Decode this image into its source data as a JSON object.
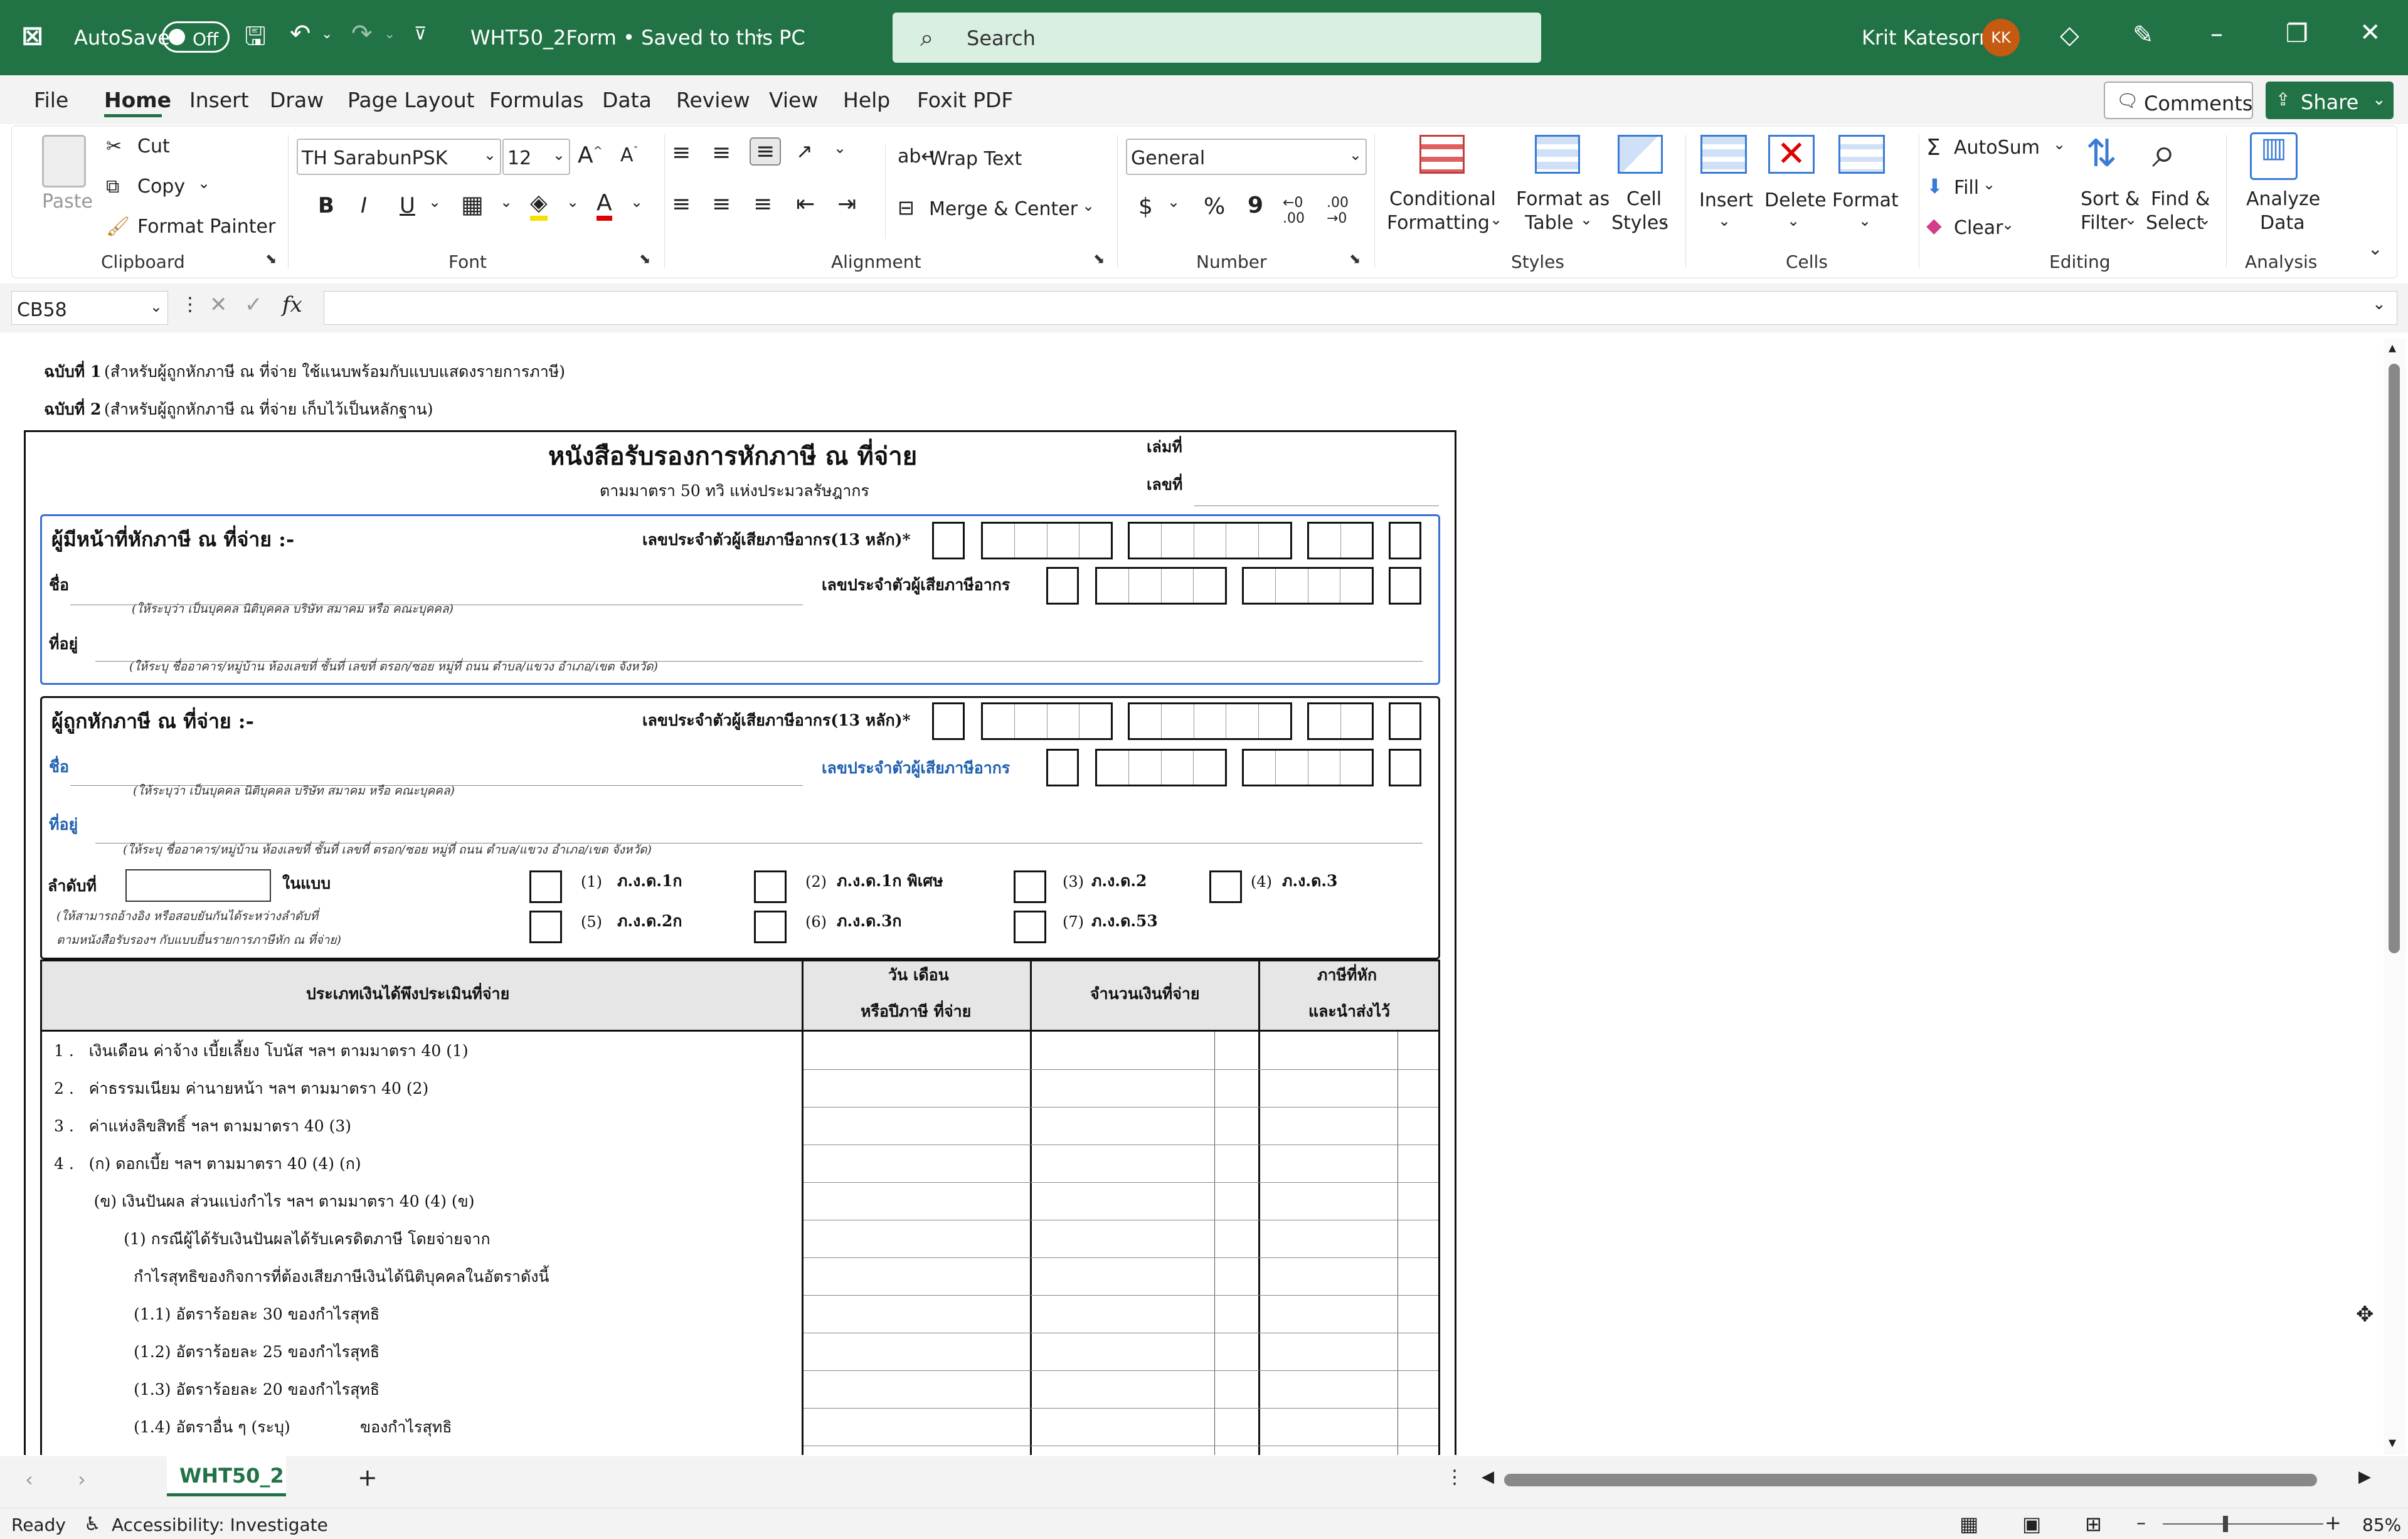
{
  "titlebar": {
    "autosave_label": "AutoSave",
    "autosave_state": "Off",
    "doc_title": "WHT50_2Form • Saved to this PC",
    "search_placeholder": "Search",
    "user_name": "Krit Katesorn",
    "user_initials": "KK"
  },
  "tabs": [
    "File",
    "Home",
    "Insert",
    "Draw",
    "Page Layout",
    "Formulas",
    "Data",
    "Review",
    "View",
    "Help",
    "Foxit PDF"
  ],
  "active_tab": "Home",
  "header_buttons": {
    "comments": "Comments",
    "share": "Share"
  },
  "ribbon": {
    "clipboard": {
      "paste": "Paste",
      "cut": "Cut",
      "copy": "Copy",
      "format_painter": "Format Painter",
      "label": "Clipboard"
    },
    "font": {
      "name": "TH SarabunPSK",
      "size": "12",
      "label": "Font",
      "bold": "B",
      "italic": "I",
      "underline": "U"
    },
    "alignment": {
      "wrap": "Wrap Text",
      "merge": "Merge & Center",
      "label": "Alignment"
    },
    "number": {
      "format": "General",
      "label": "Number",
      "dollar": "$",
      "percent": "%",
      "comma": "9"
    },
    "styles": {
      "conditional": "Conditional",
      "conditional2": "Formatting",
      "format_as": "Format as",
      "format_as2": "Table",
      "cell": "Cell",
      "cell2": "Styles",
      "label": "Styles"
    },
    "cells": {
      "insert": "Insert",
      "delete": "Delete",
      "format": "Format",
      "label": "Cells"
    },
    "editing": {
      "autosum": "AutoSum",
      "fill": "Fill",
      "clear": "Clear",
      "sort": "Sort &",
      "sort2": "Filter",
      "find": "Find &",
      "find2": "Select",
      "label": "Editing"
    },
    "analysis": {
      "analyze": "Analyze",
      "analyze2": "Data",
      "label": "Analysis"
    }
  },
  "formula_bar": {
    "name_box": "CB58",
    "fx": "fx",
    "value": ""
  },
  "form": {
    "copy1": "ฉบับที่ 1",
    "copy1_desc": "(สำหรับผู้ถูกหักภาษี ณ ที่จ่าย ใช้แนบพร้อมกับแบบแสดงรายการภาษี)",
    "copy2": "ฉบับที่ 2",
    "copy2_desc": "(สำหรับผู้ถูกหักภาษี ณ ที่จ่าย เก็บไว้เป็นหลักฐาน)",
    "title": "หนังสือรับรองการหักภาษี ณ ที่จ่าย",
    "subtitle": "ตามมาตรา 50 ทวิ แห่งประมวลรัษฎากร",
    "book_no": "เล่มที่",
    "doc_no": "เลขที่",
    "payer_heading": "ผู้มีหน้าที่หักภาษี ณ ที่จ่าย :-",
    "tax_id_13": "เลขประจำตัวผู้เสียภาษีอากร(13 หลัก)*",
    "tax_id": "เลขประจำตัวผู้เสียภาษีอากร",
    "name": "ชื่อ",
    "name_hint": "(ให้ระบุว่า เป็นบุคคล นิติบุคคล บริษัท สมาคม หรือ คณะบุคคล)",
    "address": "ที่อยู่",
    "address_hint": "(ให้ระบุ  ชื่ออาคาร/หมู่บ้าน ห้องเลขที่ ชั้นที่ เลขที่ ตรอก/ซอย  หมู่ที่ ถนน ตำบล/แขวง อำเภอ/เขต จังหวัด)",
    "payee_heading": "ผู้ถูกหักภาษี ณ ที่จ่าย :-",
    "seq": "ลำดับที่",
    "in_form": "ในแบบ",
    "seq_hint1": "(ให้สามารถอ้างอิง หรือสอบยันกันได้ระหว่างลำดับที่",
    "seq_hint2": "ตามหนังสือรับรองฯ กับแบบยื่นรายการภาษีหัก ณ ที่จ่าย)",
    "forms": [
      {
        "n": "(1)",
        "label": "ภ.ง.ด.1ก"
      },
      {
        "n": "(2)",
        "label": "ภ.ง.ด.1ก พิเศษ"
      },
      {
        "n": "(3)",
        "label": "ภ.ง.ด.2"
      },
      {
        "n": "(4)",
        "label": "ภ.ง.ด.3"
      },
      {
        "n": "(5)",
        "label": "ภ.ง.ด.2ก"
      },
      {
        "n": "(6)",
        "label": "ภ.ง.ด.3ก"
      },
      {
        "n": "(7)",
        "label": "ภ.ง.ด.53"
      }
    ],
    "table_headers": {
      "type": "ประเภทเงินได้พึงประเมินที่จ่าย",
      "date1": "วัน เดือน",
      "date2": "หรือปีภาษี ที่จ่าย",
      "amount": "จำนวนเงินที่จ่าย",
      "tax1": "ภาษีที่หัก",
      "tax2": "และนำส่งไว้"
    },
    "rows": [
      "1 .   เงินเดือน ค่าจ้าง เบี้ยเลี้ยง โบนัส ฯลฯ ตามมาตรา 40 (1)",
      "2 .   ค่าธรรมเนียม ค่านายหน้า ฯลฯ ตามมาตรา 40 (2)",
      "3 .   ค่าแห่งลิขสิทธิ์ ฯลฯ ตามมาตรา 40 (3)",
      "4 .   (ก) ดอกเบี้ย ฯลฯ ตามมาตรา 40 (4) (ก)",
      "        (ข) เงินปันผล ส่วนแบ่งกำไร ฯลฯ ตามมาตรา 40 (4) (ข)",
      "              (1) กรณีผู้ได้รับเงินปันผลได้รับเครดิตภาษี โดยจ่ายจาก",
      "                กำไรสุทธิของกิจการที่ต้องเสียภาษีเงินได้นิติบุคคลในอัตราดังนี้",
      "                (1.1) อัตราร้อยละ 30 ของกำไรสุทธิ",
      "                (1.2) อัตราร้อยละ 25 ของกำไรสุทธิ",
      "                (1.3) อัตราร้อยละ 20 ของกำไรสุทธิ",
      "                (1.4) อัตราอื่น ๆ (ระบุ)              ของกำไรสุทธิ"
    ]
  },
  "sheet_tab": "WHT50_2",
  "status": {
    "ready": "Ready",
    "accessibility": "Accessibility: Investigate",
    "zoom": "85%"
  }
}
